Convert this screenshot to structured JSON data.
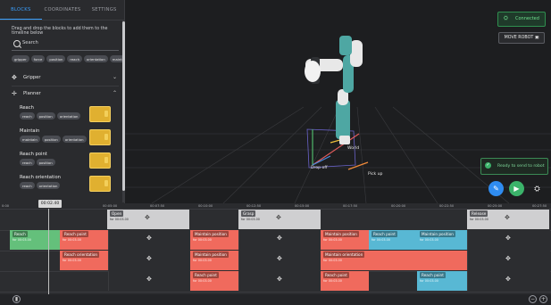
{
  "tabs": [
    "BLOCKS",
    "COORDINATES",
    "SETTINGS"
  ],
  "panel": {
    "hint": "Drag and drop the blocks to add them to the timeline below",
    "search_placeholder": "Search",
    "chips": [
      "gripper",
      "force",
      "position",
      "reach",
      "orientation",
      "maintain"
    ],
    "sections": [
      {
        "label": "Gripper",
        "icon": "gripper-icon",
        "chevron": "⌄"
      },
      {
        "label": "Planner",
        "icon": "planner-icon",
        "chevron": "⌃"
      }
    ],
    "blocks": [
      {
        "title": "Reach",
        "chips": [
          "reach",
          "position",
          "orientation"
        ]
      },
      {
        "title": "Maintain",
        "chips": [
          "maintain",
          "position",
          "orientation"
        ]
      },
      {
        "title": "Reach point",
        "chips": [
          "reach",
          "position"
        ]
      },
      {
        "title": "Reach orientation",
        "chips": [
          "reach",
          "orientation"
        ]
      }
    ]
  },
  "viewport": {
    "connected_label": "Connected",
    "move_robot_label": "MOVE ROBOT",
    "toast_text": "Ready to send to robot",
    "labels": {
      "world": "World",
      "drop_off": "Drop off",
      "pick_up": "Pick up"
    },
    "accent": "#3aa0ff",
    "success": "#3bb36a"
  },
  "timeline": {
    "current_time": "00:02.40",
    "ticks": [
      "0:00",
      "00:02.40",
      "00:05:00",
      "00:07:50",
      "00:10:00",
      "00:12:50",
      "00:15:00",
      "00:17:50",
      "00:20:00",
      "00:22:50",
      "00:25:00",
      "00:27:50",
      "00:30:00",
      "00:32:50"
    ],
    "rows": [
      [
        {
          "title": "Open",
          "sub": "for 00:03.00",
          "color": "grey"
        },
        {
          "title": "Grasp",
          "sub": "for 00:03.00",
          "color": "grey"
        },
        {
          "title": "Release",
          "sub": "for 00:03.00",
          "color": "grey"
        }
      ],
      [
        {
          "title": "Reach",
          "sub": "for 00:03.00",
          "color": "green"
        },
        {
          "title": "Reach point",
          "sub": "for 00:03.00",
          "color": "red"
        },
        {
          "title": "Maintain position",
          "sub": "for 00:03.00",
          "color": "red"
        },
        {
          "title": "Maintain position",
          "sub": "for 00:03.00",
          "color": "red"
        },
        {
          "title": "Reach point",
          "sub": "for 00:03.00",
          "color": "blue"
        },
        {
          "title": "Maintain position",
          "sub": "for 00:03.00",
          "color": "blue"
        }
      ],
      [
        {
          "title": "Reach orientation",
          "sub": "for 00:03.00",
          "color": "red"
        },
        {
          "title": "Maintain position",
          "sub": "for 00:03.00",
          "color": "red"
        },
        {
          "title": "Maintain orientation",
          "sub": "for 00:03.00",
          "color": "red"
        }
      ],
      [
        {
          "title": "Reach point",
          "sub": "for 00:03.00",
          "color": "red"
        },
        {
          "title": "Reach point",
          "sub": "for 00:03.00",
          "color": "red"
        },
        {
          "title": "Reach point",
          "sub": "for 00:03.00",
          "color": "blue"
        }
      ]
    ]
  }
}
